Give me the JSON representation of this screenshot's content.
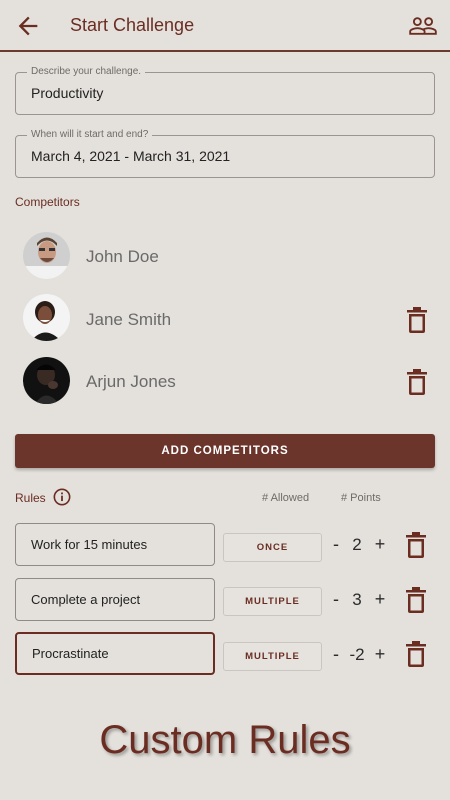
{
  "appbar": {
    "title": "Start Challenge"
  },
  "description": {
    "label": "Describe your challenge.",
    "value": "Productivity"
  },
  "dates": {
    "label": "When will it start and end?",
    "value": "March 4, 2021 - March 31, 2021"
  },
  "competitors": {
    "label": "Competitors",
    "items": [
      {
        "name": "John Doe"
      },
      {
        "name": "Jane Smith"
      },
      {
        "name": "Arjun Jones"
      }
    ],
    "add_label": "ADD COMPETITORS"
  },
  "rules": {
    "label": "Rules",
    "col_allowed": "# Allowed",
    "col_points": "# Points",
    "items": [
      {
        "text": "Work for 15 minutes",
        "frequency": "ONCE",
        "points": "2"
      },
      {
        "text": "Complete a project",
        "frequency": "MULTIPLE",
        "points": "3"
      },
      {
        "text": "Procrastinate",
        "frequency": "MULTIPLE",
        "points": "-2"
      }
    ],
    "minus": "-",
    "plus": "+"
  },
  "caption": "Custom Rules",
  "colors": {
    "accent": "#6b2d22",
    "button": "#6b352b",
    "background": "#e4e1dc"
  }
}
